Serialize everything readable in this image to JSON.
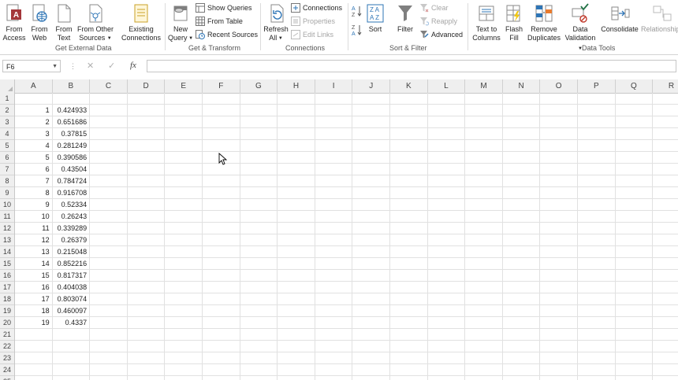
{
  "ribbon": {
    "groups": [
      {
        "label": "Get External Data"
      },
      {
        "label": "Get & Transform"
      },
      {
        "label": "Connections"
      },
      {
        "label": "Sort & Filter"
      },
      {
        "label": "Data Tools"
      }
    ],
    "from_access": [
      "From",
      "Access"
    ],
    "from_web": [
      "From",
      "Web"
    ],
    "from_text": [
      "From",
      "Text"
    ],
    "from_other": [
      "From Other",
      "Sources"
    ],
    "existing": [
      "Existing",
      "Connections"
    ],
    "new_query": [
      "New",
      "Query"
    ],
    "show_queries": "Show Queries",
    "from_table": "From Table",
    "recent_sources": "Recent Sources",
    "refresh_all": [
      "Refresh",
      "All"
    ],
    "connections": "Connections",
    "properties": "Properties",
    "edit_links": "Edit Links",
    "sort": "Sort",
    "filter": "Filter",
    "clear": "Clear",
    "reapply": "Reapply",
    "advanced": "Advanced",
    "text_to_columns": [
      "Text to",
      "Columns"
    ],
    "flash_fill": [
      "Flash",
      "Fill"
    ],
    "remove_duplicates": [
      "Remove",
      "Duplicates"
    ],
    "data_validation": [
      "Data",
      "Validation"
    ],
    "consolidate": "Consolidate",
    "relationships": "Relationships"
  },
  "formula_bar": {
    "name_box": "F6",
    "formula": ""
  },
  "sheet": {
    "columns": [
      "A",
      "B",
      "C",
      "D",
      "E",
      "F",
      "G",
      "H",
      "I",
      "J",
      "K",
      "L",
      "M",
      "N",
      "O",
      "P",
      "Q",
      "R"
    ],
    "rows": [
      "1",
      "2",
      "3",
      "4",
      "5",
      "6",
      "7",
      "8",
      "9",
      "10",
      "11",
      "12",
      "13",
      "14",
      "15",
      "16",
      "17",
      "18",
      "19",
      "20",
      "21",
      "22",
      "23",
      "24",
      "25"
    ],
    "data": [
      [
        "1",
        "0.424933"
      ],
      [
        "2",
        "0.651686"
      ],
      [
        "3",
        "0.37815"
      ],
      [
        "4",
        "0.281249"
      ],
      [
        "5",
        "0.390586"
      ],
      [
        "6",
        "0.43504"
      ],
      [
        "7",
        "0.784724"
      ],
      [
        "8",
        "0.916708"
      ],
      [
        "9",
        "0.52334"
      ],
      [
        "10",
        "0.26243"
      ],
      [
        "11",
        "0.339289"
      ],
      [
        "12",
        "0.26379"
      ],
      [
        "13",
        "0.215048"
      ],
      [
        "14",
        "0.852216"
      ],
      [
        "15",
        "0.817317"
      ],
      [
        "16",
        "0.404038"
      ],
      [
        "17",
        "0.803074"
      ],
      [
        "18",
        "0.460097"
      ],
      [
        "19",
        "0.4337"
      ]
    ]
  },
  "colors": {
    "accent": "#217346",
    "grid_line": "#e1e1e1",
    "header_bg": "#efefef"
  }
}
